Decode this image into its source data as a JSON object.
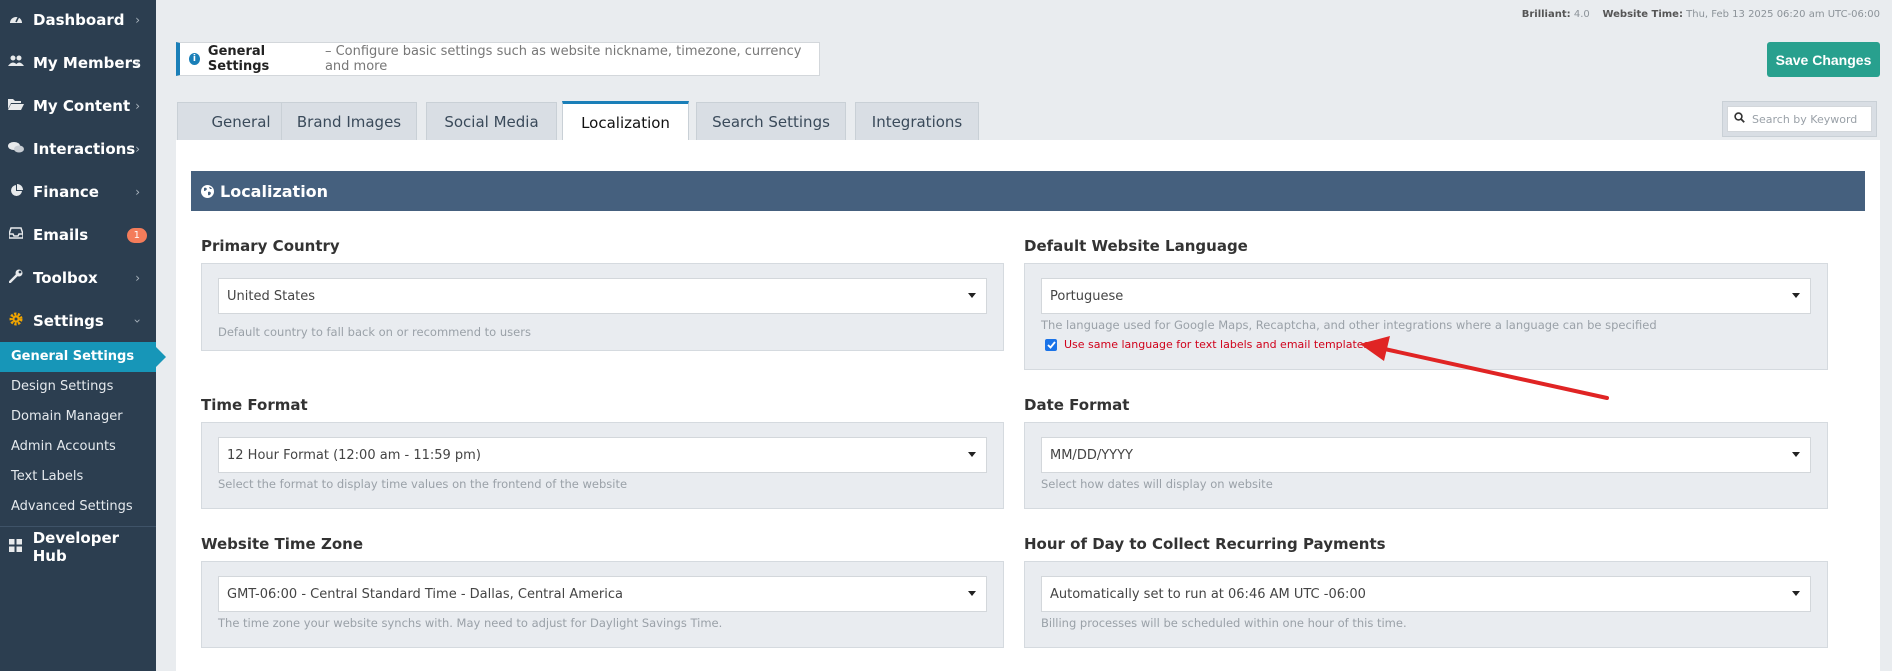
{
  "sidebar": {
    "items": [
      {
        "label": "Dashboard",
        "icon": "speedometer-icon"
      },
      {
        "label": "My Members",
        "icon": "users-icon"
      },
      {
        "label": "My Content",
        "icon": "folder-open-icon"
      },
      {
        "label": "Interactions",
        "icon": "chat-bubbles-icon"
      },
      {
        "label": "Finance",
        "icon": "pie-chart-icon"
      },
      {
        "label": "Emails",
        "icon": "inbox-icon",
        "badge": "1"
      },
      {
        "label": "Toolbox",
        "icon": "wrench-icon"
      },
      {
        "label": "Settings",
        "icon": "gear-icon"
      }
    ],
    "settings_sub": [
      {
        "label": "General Settings",
        "active": true
      },
      {
        "label": "Design Settings"
      },
      {
        "label": "Domain Manager"
      },
      {
        "label": "Admin Accounts"
      },
      {
        "label": "Text Labels"
      },
      {
        "label": "Advanced Settings"
      }
    ],
    "developer_hub": "Developer Hub"
  },
  "topbar": {
    "version_label": "Brilliant:",
    "version_value": "4.0",
    "time_label": "Website Time:",
    "time_value": "Thu, Feb 13 2025 06:20 am UTC-06:00"
  },
  "infobox": {
    "title": "General Settings",
    "description": "– Configure basic settings such as website nickname, timezone, currency and more"
  },
  "save_label": "Save Changes",
  "tabs": [
    "General",
    "Brand Images",
    "Social Media",
    "Localization",
    "Search Settings",
    "Integrations"
  ],
  "active_tab": "Localization",
  "search": {
    "placeholder": "Search by Keyword"
  },
  "section_title": "Localization",
  "fields": {
    "primary_country": {
      "label": "Primary Country",
      "value": "United States",
      "help": "Default country to fall back on or recommend to users"
    },
    "default_language": {
      "label": "Default Website Language",
      "value": "Portuguese",
      "help": "The language used for Google Maps, Recaptcha, and other integrations where a language can be specified",
      "checkbox_label": "Use same language for text labels and email templates",
      "checked": true
    },
    "time_format": {
      "label": "Time Format",
      "value": "12 Hour Format (12:00 am - 11:59 pm)",
      "help": "Select the format to display time values on the frontend of the website"
    },
    "date_format": {
      "label": "Date Format",
      "value": "MM/DD/YYYY",
      "help": "Select how dates will display on website"
    },
    "time_zone": {
      "label": "Website Time Zone",
      "value": "GMT-06:00 - Central Standard Time - Dallas, Central America",
      "help": "The time zone your website synchs with. May need to adjust for Daylight Savings Time."
    },
    "recurring_hour": {
      "label": "Hour of Day to Collect Recurring Payments",
      "value": "Automatically set to run at 06:46 AM UTC -06:00",
      "help": "Billing processes will be scheduled within one hour of this time."
    }
  },
  "colors": {
    "sidebar": "#2c3e50",
    "accent": "#1796b8",
    "save": "#28a08e",
    "section_header": "#45607e",
    "annotation": "#e02424"
  }
}
